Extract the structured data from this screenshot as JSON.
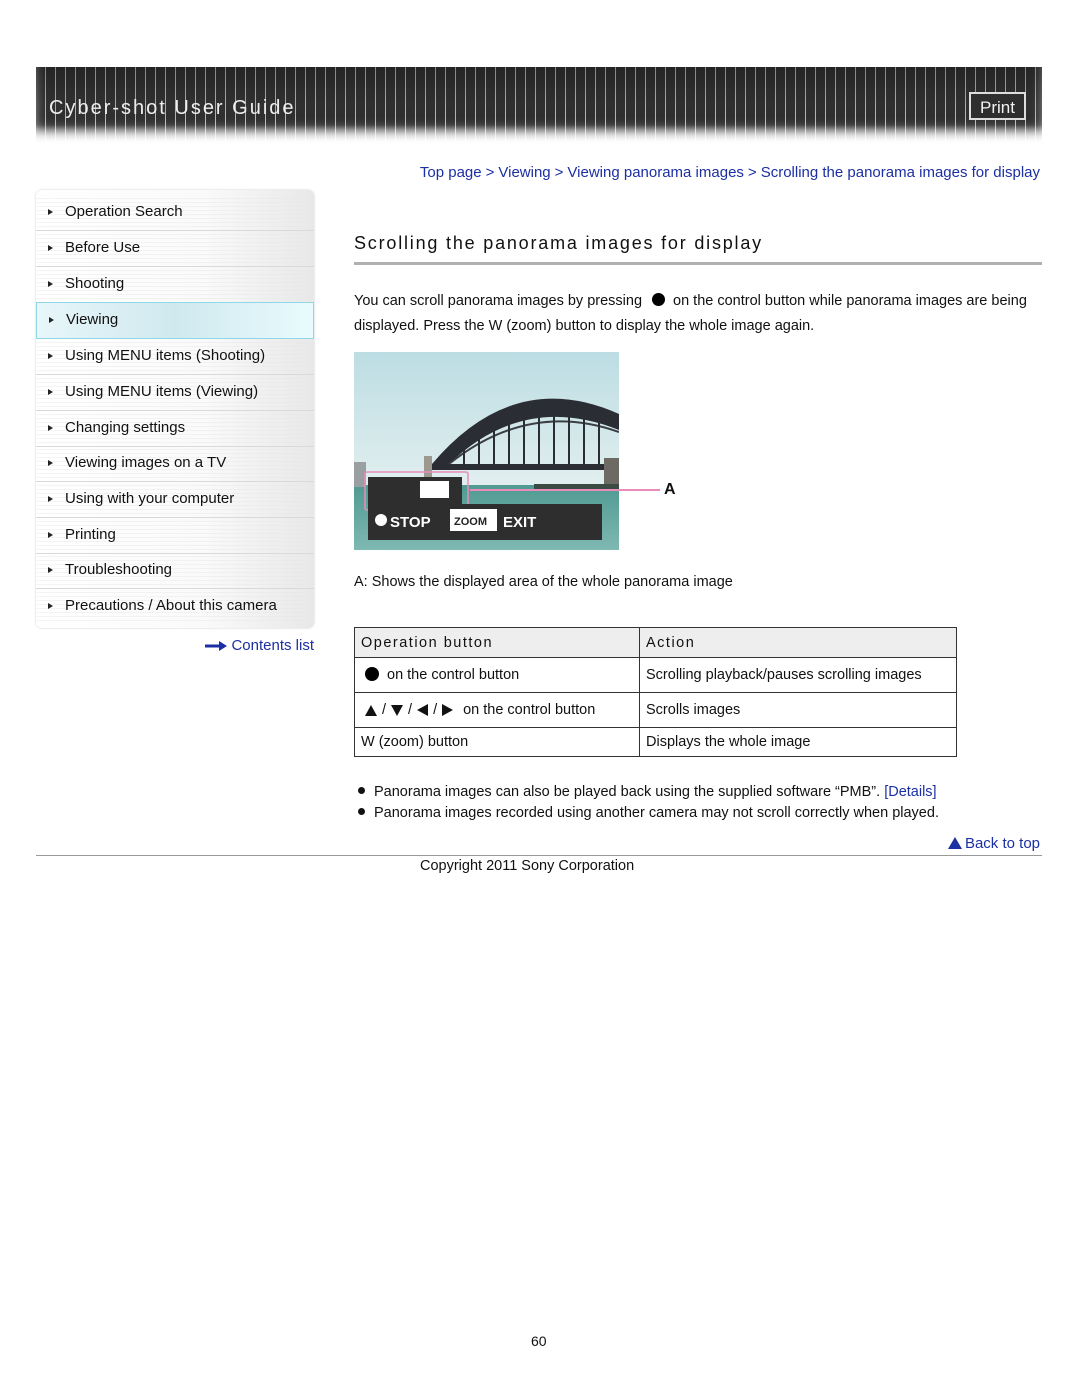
{
  "header": {
    "app_title": "Cyber-shot User Guide",
    "print_label": "Print"
  },
  "breadcrumb": {
    "items": [
      "Top page",
      "Viewing",
      "Viewing panorama images",
      "Scrolling the panorama images for display"
    ],
    "separator": ">"
  },
  "sidebar": {
    "items": [
      {
        "label": "Operation Search",
        "active": false
      },
      {
        "label": "Before Use",
        "active": false
      },
      {
        "label": "Shooting",
        "active": false
      },
      {
        "label": "Viewing",
        "active": true
      },
      {
        "label": "Using MENU items (Shooting)",
        "active": false
      },
      {
        "label": "Using MENU items (Viewing)",
        "active": false
      },
      {
        "label": "Changing settings",
        "active": false
      },
      {
        "label": "Viewing images on a TV",
        "active": false
      },
      {
        "label": "Using with your computer",
        "active": false
      },
      {
        "label": "Printing",
        "active": false
      },
      {
        "label": "Troubleshooting",
        "active": false
      },
      {
        "label": "Precautions / About this camera",
        "active": false
      }
    ],
    "contents_list_label": "Contents list"
  },
  "main": {
    "title": "Scrolling the panorama images for display",
    "intro_part1": "You can scroll panorama images by pressing",
    "intro_part2": "on the control button while panorama images are being displayed. Press the W (zoom) button to display the whole image again.",
    "figure": {
      "label": "A",
      "overlay_stop": "STOP",
      "overlay_zoom": "ZOOM",
      "overlay_exit": "EXIT"
    },
    "caption": "A: Shows the displayed area of the whole panorama image",
    "table": {
      "headers": [
        "Operation button",
        "Action"
      ],
      "rows": [
        {
          "button": "on the control button",
          "action": "Scrolling playback/pauses scrolling images",
          "icon": "center-button"
        },
        {
          "button": "on the control button",
          "action": "Scrolls images",
          "icon": "direction-buttons"
        },
        {
          "button": "W (zoom) button",
          "action": "Displays the whole image",
          "icon": "none"
        }
      ],
      "slash": "/"
    },
    "notes": [
      {
        "text": "Panorama images can also be played back using the supplied software “PMB”.",
        "link": "[Details]"
      },
      {
        "text": "Panorama images recorded using another camera may not scroll correctly when played."
      }
    ],
    "back_to_top": "Back to top"
  },
  "footer": {
    "copyright": "Copyright 2011 Sony Corporation",
    "page_number": "60"
  },
  "colors": {
    "link": "#1c2fa3",
    "header_bg": "#2e2e2e",
    "active_item_bg": "#d6eef3",
    "active_item_border": "#8fd6e8",
    "figure_highlight": "#e98cba"
  }
}
